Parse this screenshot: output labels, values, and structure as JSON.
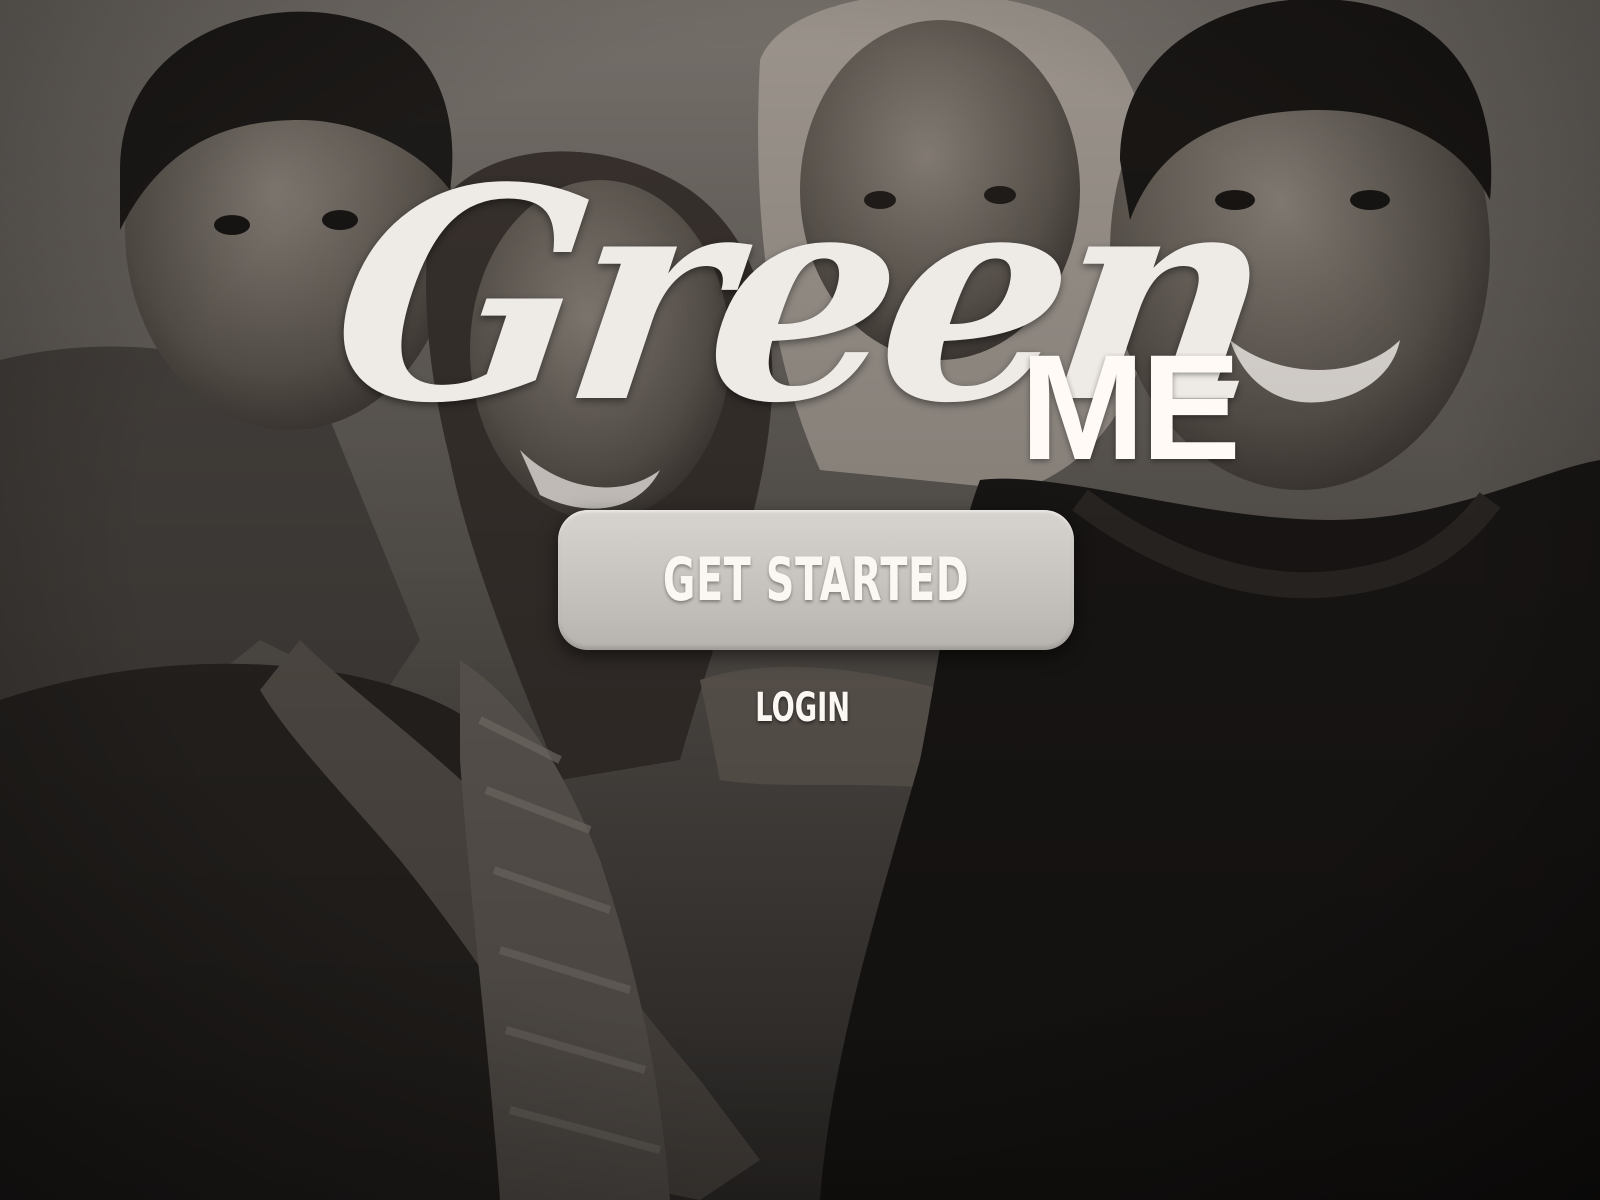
{
  "logo": {
    "script_text": "Green",
    "block_text": "ME"
  },
  "actions": {
    "get_started_label": "GET STARTED",
    "login_label": "LOGIN"
  },
  "colors": {
    "logo_text": "#eeeae6",
    "button_fill": "#c8c4bf",
    "button_text": "#fbf7f2",
    "photo_tone": "#3c3835"
  }
}
